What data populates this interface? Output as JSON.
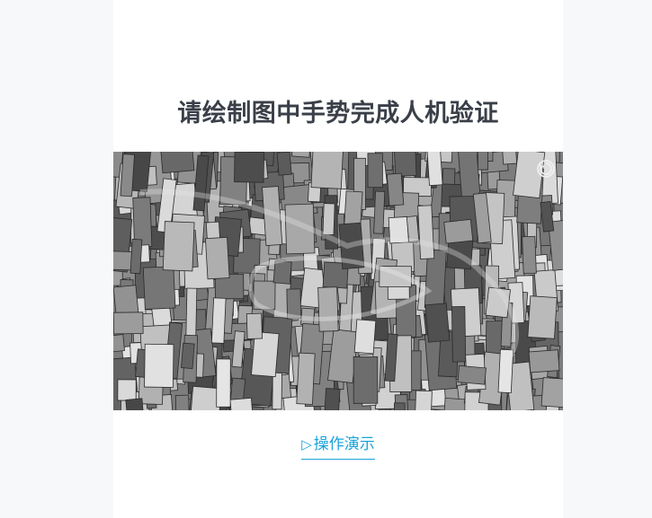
{
  "title": "请绘制图中手势完成人机验证",
  "captcha": {
    "refresh_icon": "refresh-icon"
  },
  "demo": {
    "icon": "play-icon",
    "icon_glyph": "▷",
    "label": "操作演示"
  },
  "colors": {
    "title": "#3a3f48",
    "link": "#1aa3d9",
    "background": "#f6f8fa",
    "panel": "#ffffff"
  }
}
